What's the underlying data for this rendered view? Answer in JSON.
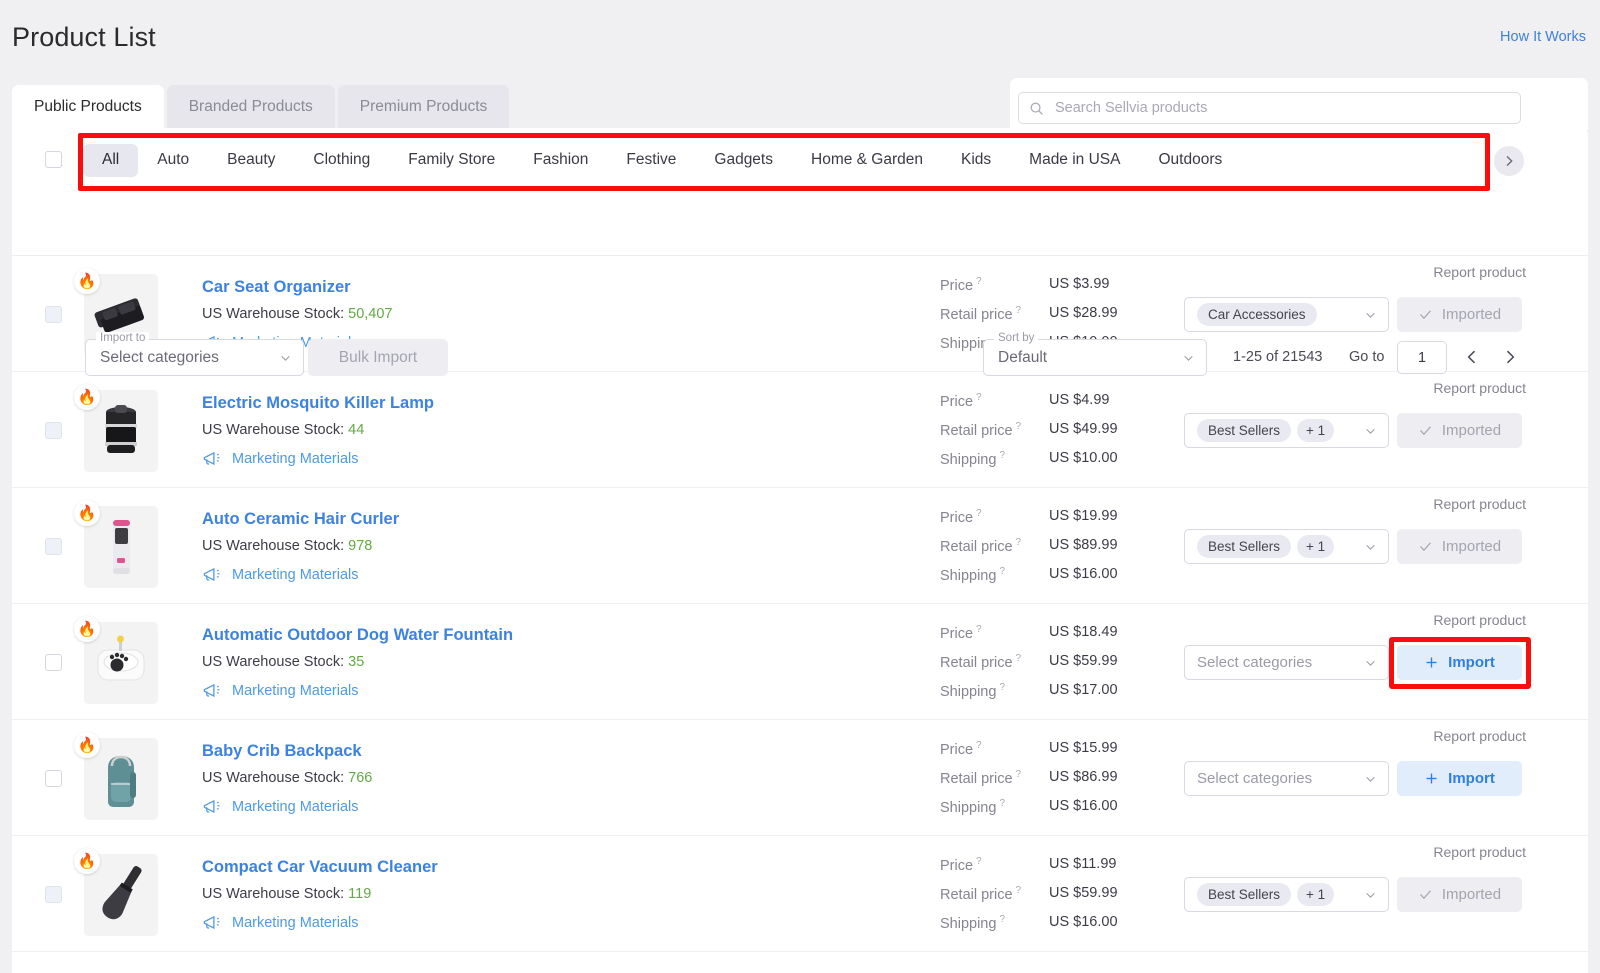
{
  "header": {
    "title": "Product List",
    "how_it_works": "How It Works"
  },
  "tabs": [
    {
      "label": "Public Products",
      "active": true
    },
    {
      "label": "Branded Products",
      "active": false
    },
    {
      "label": "Premium Products",
      "active": false
    }
  ],
  "search": {
    "placeholder": "Search Sellvia products",
    "value": "",
    "icon": "search-icon"
  },
  "categories": {
    "prev_icon": "chevron-left-icon",
    "next_icon": "chevron-right-icon",
    "items": [
      {
        "label": "All",
        "active": true
      },
      {
        "label": "Auto",
        "active": false
      },
      {
        "label": "Beauty",
        "active": false
      },
      {
        "label": "Clothing",
        "active": false
      },
      {
        "label": "Family Store",
        "active": false
      },
      {
        "label": "Fashion",
        "active": false
      },
      {
        "label": "Festive",
        "active": false
      },
      {
        "label": "Gadgets",
        "active": false
      },
      {
        "label": "Home & Garden",
        "active": false
      },
      {
        "label": "Kids",
        "active": false
      },
      {
        "label": "Made in USA",
        "active": false
      },
      {
        "label": "Outdoors",
        "active": false
      }
    ]
  },
  "toolbar": {
    "import_to_legend": "Import to",
    "import_to_value": "Select categories",
    "bulk_import_label": "Bulk Import",
    "sort_by_legend": "Sort by",
    "sort_by_value": "Default",
    "pagination_count": "1-25 of 21543",
    "goto_label": "Go to",
    "goto_value": "1",
    "prev_icon": "chevron-left-icon",
    "next_icon": "chevron-right-icon"
  },
  "labels": {
    "price": "Price",
    "retail_price": "Retail price",
    "shipping": "Shipping",
    "marketing_materials": "Marketing Materials",
    "report_product": "Report product",
    "select_categories": "Select categories",
    "imported": "Imported",
    "import": "Import",
    "stock_prefix": "US Warehouse Stock:",
    "tooltip_marker": "?"
  },
  "colors": {
    "link": "#3c82e0",
    "stock": "#63a945",
    "import_accent": "#2f7fe0",
    "highlight": "#fb0d0d",
    "page_bg": "#f0f0f2",
    "panel_bg": "#ffffff"
  },
  "products": [
    {
      "name": "Car Seat Organizer",
      "stock": "50,407",
      "price": "US $3.99",
      "retail_price": "US $28.99",
      "shipping": "US $10.00",
      "category_tags": [
        "Car Accessories"
      ],
      "extra_tag": "",
      "has_category": true,
      "action": "Imported",
      "action_state": "imported",
      "highlighted": false,
      "thumb": "car-seat-organizer"
    },
    {
      "name": "Electric Mosquito Killer Lamp",
      "stock": "44",
      "price": "US $4.99",
      "retail_price": "US $49.99",
      "shipping": "US $10.00",
      "category_tags": [
        "Best Sellers"
      ],
      "extra_tag": "+ 1",
      "has_category": true,
      "action": "Imported",
      "action_state": "imported",
      "highlighted": false,
      "thumb": "mosquito-lamp"
    },
    {
      "name": "Auto Ceramic Hair Curler",
      "stock": "978",
      "price": "US $19.99",
      "retail_price": "US $89.99",
      "shipping": "US $16.00",
      "category_tags": [
        "Best Sellers"
      ],
      "extra_tag": "+ 1",
      "has_category": true,
      "action": "Imported",
      "action_state": "imported",
      "highlighted": false,
      "thumb": "hair-curler"
    },
    {
      "name": "Automatic Outdoor Dog Water Fountain",
      "stock": "35",
      "price": "US $18.49",
      "retail_price": "US $59.99",
      "shipping": "US $17.00",
      "category_tags": [],
      "extra_tag": "",
      "has_category": false,
      "action": "Import",
      "action_state": "import",
      "highlighted": true,
      "thumb": "dog-fountain"
    },
    {
      "name": "Baby Crib Backpack",
      "stock": "766",
      "price": "US $15.99",
      "retail_price": "US $86.99",
      "shipping": "US $16.00",
      "category_tags": [],
      "extra_tag": "",
      "has_category": false,
      "action": "Import",
      "action_state": "import",
      "highlighted": false,
      "thumb": "backpack"
    },
    {
      "name": "Compact Car Vacuum Cleaner",
      "stock": "119",
      "price": "US $11.99",
      "retail_price": "US $59.99",
      "shipping": "US $16.00",
      "category_tags": [
        "Best Sellers"
      ],
      "extra_tag": "+ 1",
      "has_category": true,
      "action": "Imported",
      "action_state": "imported",
      "highlighted": false,
      "thumb": "vacuum"
    }
  ]
}
